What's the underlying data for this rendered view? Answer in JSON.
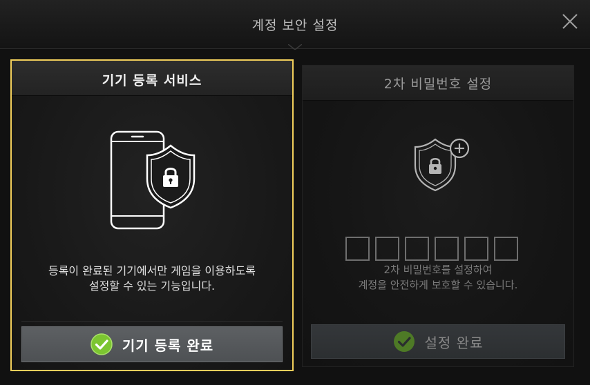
{
  "dialog": {
    "title": "계정 보안 설정",
    "close_icon": "close-icon"
  },
  "device_card": {
    "title": "기기 등록 서비스",
    "icon": "phone-shield-lock-icon",
    "description_line1": "등록이 완료된 기기에서만 게임을 이용하도록",
    "description_line2": "설정할 수 있는 기능입니다.",
    "button_label": "기기 등록 완료",
    "button_icon": "check-circle-icon",
    "selected": true,
    "accent_color": "#f2cf5b",
    "check_color": "#7cc531"
  },
  "password_card": {
    "title": "2차 비밀번호 설정",
    "icon": "shield-lock-plus-icon",
    "pin_slots": 6,
    "description_line1": "2차 비밀번호를 설정하여",
    "description_line2": "계정을 안전하게 보호할 수 있습니다.",
    "button_label": "설정 완료",
    "button_icon": "check-circle-icon",
    "check_color": "#4e7a26"
  }
}
